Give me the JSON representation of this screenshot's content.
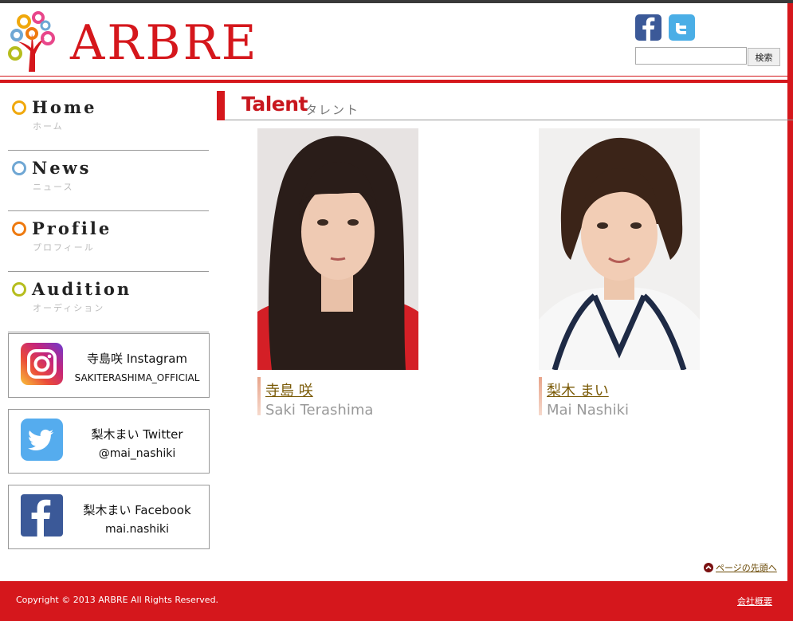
{
  "header": {
    "logo_text": "ARBRE",
    "search": {
      "button_label": "検索",
      "value": ""
    },
    "social_icons": [
      "facebook-icon",
      "twitter-icon"
    ]
  },
  "nav": {
    "items": [
      {
        "label_en": "Home",
        "label_jp": "ホーム",
        "color": "#f0a80c"
      },
      {
        "label_en": "News",
        "label_jp": "ニュース",
        "color": "#6fa7d4"
      },
      {
        "label_en": "Profile",
        "label_jp": "プロフィール",
        "color": "#ee7a10"
      },
      {
        "label_en": "Audition",
        "label_jp": "オーディション",
        "color": "#b6bd1d"
      }
    ],
    "sns_links": [
      {
        "line1": "寺島咲 Instagram",
        "line2": "SAKITERASHIMA_OFFICIAL",
        "icon": "instagram-icon"
      },
      {
        "line1": "梨木まい Twitter",
        "line2": "@mai_nashiki",
        "icon": "twitter-icon"
      },
      {
        "line1": "梨木まい Facebook",
        "line2": "mai.nashiki",
        "icon": "facebook-icon"
      }
    ]
  },
  "main": {
    "title": "Talent",
    "subtitle": "タレント",
    "talents": [
      {
        "name_jp": "寺島 咲",
        "name_en": "Saki Terashima"
      },
      {
        "name_jp": "梨木 まい",
        "name_en": "Mai Nashiki"
      }
    ]
  },
  "page_top_label": "ページの先頭へ",
  "footer": {
    "copyright": "Copyright © 2013 ARBRE All Rights Reserved.",
    "company_link": "会社概要"
  },
  "colors": {
    "brand_red": "#d5171c",
    "link_brown": "#7a5a06"
  }
}
